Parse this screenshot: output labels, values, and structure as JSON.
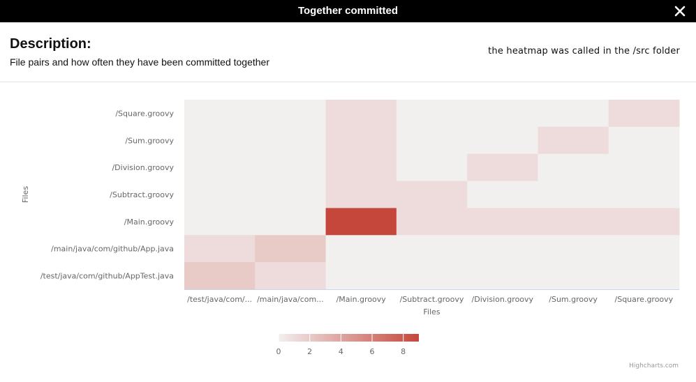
{
  "dialog": {
    "title": "Together committed",
    "description_heading": "Description:",
    "description_text": "File pairs and how often they have been committed together",
    "note": "the heatmap was called in the /src folder",
    "credits": "Highcharts.com"
  },
  "chart_data": {
    "type": "heatmap",
    "title": "",
    "xlabel": "Files",
    "ylabel": "Files",
    "x_categories": [
      "/test/java/com/...",
      "/main/java/com...",
      "/Main.groovy",
      "/Subtract.groovy",
      "/Division.groovy",
      "/Sum.groovy",
      "/Square.groovy"
    ],
    "y_categories": [
      "/Square.groovy",
      "/Sum.groovy",
      "/Division.groovy",
      "/Subtract.groovy",
      "/Main.groovy",
      "/main/java/com/github/App.java",
      "/test/java/com/github/AppTest.java"
    ],
    "values": [
      [
        0,
        0,
        1,
        0,
        0,
        0,
        1
      ],
      [
        0,
        0,
        1,
        0,
        0,
        1,
        0
      ],
      [
        0,
        0,
        1,
        0,
        1,
        0,
        0
      ],
      [
        0,
        0,
        1,
        1,
        0,
        0,
        0
      ],
      [
        0,
        0,
        9,
        1,
        1,
        1,
        1
      ],
      [
        1,
        2,
        0,
        0,
        0,
        0,
        0
      ],
      [
        2,
        1,
        0,
        0,
        0,
        0,
        0
      ]
    ],
    "color_axis": {
      "min": 0,
      "max": 9,
      "ticks": [
        "0",
        "2",
        "4",
        "6",
        "8"
      ],
      "min_color": "#f2efef",
      "max_color": "#c5473b"
    },
    "grid": false,
    "legend_position": "bottom-center"
  }
}
